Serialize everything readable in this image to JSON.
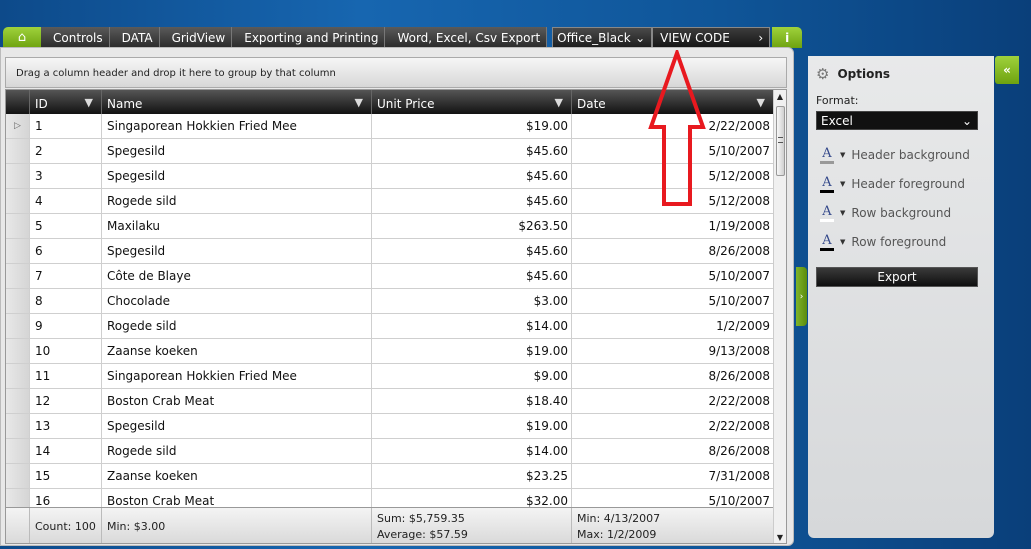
{
  "breadcrumb": {
    "items": [
      "Controls",
      "DATA",
      "GridView",
      "Exporting and Printing",
      "Word, Excel, Csv Export"
    ],
    "theme": "Office_Black",
    "view_code": "VIEW CODE"
  },
  "grid": {
    "group_hint": "Drag a column header and drop it here to group by that column",
    "columns": [
      "ID",
      "Name",
      "Unit Price",
      "Date"
    ],
    "rows": [
      [
        "1",
        "Singaporean Hokkien Fried Mee",
        "$19.00",
        "2/22/2008"
      ],
      [
        "2",
        "Spegesild",
        "$45.60",
        "5/10/2007"
      ],
      [
        "3",
        "Spegesild",
        "$45.60",
        "5/12/2008"
      ],
      [
        "4",
        "Rogede sild",
        "$45.60",
        "5/12/2008"
      ],
      [
        "5",
        "Maxilaku",
        "$263.50",
        "1/19/2008"
      ],
      [
        "6",
        "Spegesild",
        "$45.60",
        "8/26/2008"
      ],
      [
        "7",
        "Côte de Blaye",
        "$45.60",
        "5/10/2007"
      ],
      [
        "8",
        "Chocolade",
        "$3.00",
        "5/10/2007"
      ],
      [
        "9",
        "Rogede sild",
        "$14.00",
        "1/2/2009"
      ],
      [
        "10",
        "Zaanse koeken",
        "$19.00",
        "9/13/2008"
      ],
      [
        "11",
        "Singaporean Hokkien Fried Mee",
        "$9.00",
        "8/26/2008"
      ],
      [
        "12",
        "Boston Crab Meat",
        "$18.40",
        "2/22/2008"
      ],
      [
        "13",
        "Spegesild",
        "$19.00",
        "2/22/2008"
      ],
      [
        "14",
        "Rogede sild",
        "$14.00",
        "8/26/2008"
      ],
      [
        "15",
        "Zaanse koeken",
        "$23.25",
        "7/31/2008"
      ],
      [
        "16",
        "Boston Crab Meat",
        "$32.00",
        "5/10/2007"
      ]
    ],
    "footer": {
      "count": "Count: 100",
      "min_price": "Min: $3.00",
      "sum": "Sum: $5,759.35",
      "average": "Average: $57.59",
      "min_date": "Min: 4/13/2007",
      "max_date": "Max: 1/2/2009"
    }
  },
  "options": {
    "title": "Options",
    "format_label": "Format:",
    "format_value": "Excel",
    "color_options": [
      {
        "label": "Header background",
        "swatch": "#999999"
      },
      {
        "label": "Header foreground",
        "swatch": "#000000"
      },
      {
        "label": "Row background",
        "swatch": "#ffffff"
      },
      {
        "label": "Row foreground",
        "swatch": "#000000"
      }
    ],
    "export_label": "Export"
  },
  "colors": {
    "accent_green": "#7fb52a",
    "annotation_red": "#e8191f"
  }
}
